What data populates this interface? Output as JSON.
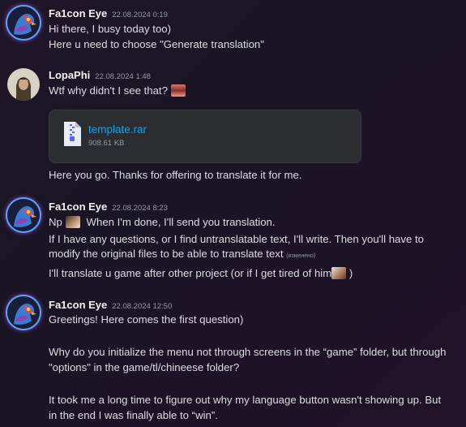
{
  "messages": [
    {
      "author": "Fa1con Eye",
      "timestamp": "22.08.2024 0:19",
      "lines": [
        "Hi there, I busy today too)",
        "Here u need to choose \"Generate translation\""
      ]
    },
    {
      "author": "LopaPhi",
      "timestamp": "22.08.2024 1:48",
      "text": "Wtf why didn't I see that?",
      "attachment": {
        "filename": "template.rar",
        "size": "908.61 KB"
      },
      "followup": "Here you go. Thanks for offering to translate it for me."
    },
    {
      "author": "Fa1con Eye",
      "timestamp": "22.08.2024 8:23",
      "line1_a": "Np",
      "line1_b": "When I'm done, I'll send you translation.",
      "line2": "If I have any questions, or I find untranslatable text, I'll write. Then you'll have to",
      "line3": "modify the original files to be able to translate text",
      "edited": "(изменено)",
      "line4_a": "I'll translate u game after other project (or if I get tired of him",
      "line4_b": ")"
    },
    {
      "author": "Fa1con Eye",
      "timestamp": "22.08.2024 12:50",
      "lines": [
        "Greetings! Here comes the first question)",
        "Why do you initialize the menu not through screens in the “game” folder, but through",
        "\"options\" in the game/tl/chineese folder?",
        "It took me a long time to figure out why my language button wasn't showing up. But",
        "in the end I was finally able to “win”."
      ]
    }
  ]
}
